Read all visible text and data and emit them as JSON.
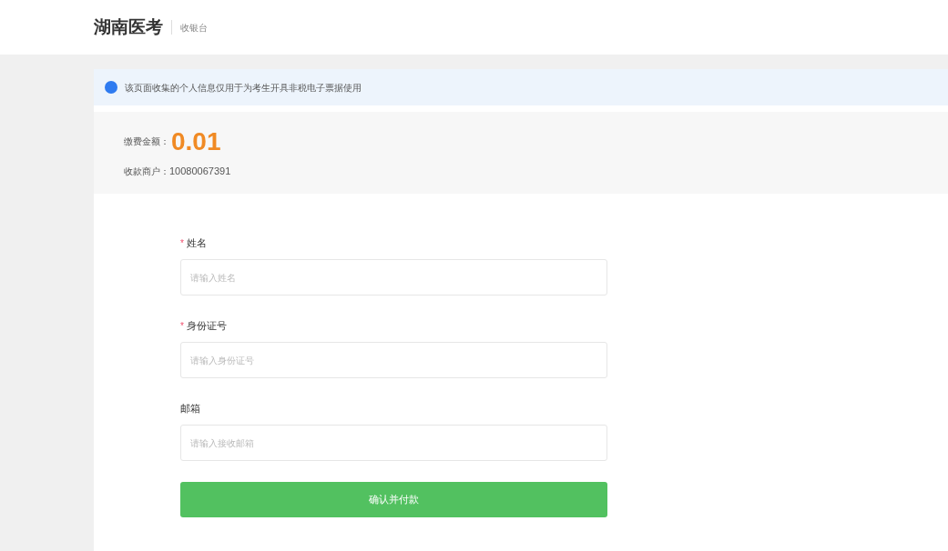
{
  "header": {
    "brand": "湖南医考",
    "subtitle": "收银台"
  },
  "notice": {
    "text": "该页面收集的个人信息仅用于为考生开具非税电子票据使用"
  },
  "payment": {
    "amount_label": "缴费金额：",
    "amount": "0.01",
    "merchant_label": "收款商户：",
    "merchant": "10080067391"
  },
  "fields": [
    {
      "mark": "*",
      "label": "姓名",
      "placeholder": "请输入姓名"
    },
    {
      "mark": "*",
      "label": "身份证号",
      "placeholder": "请输入身份证号"
    },
    {
      "label": "邮箱",
      "placeholder": "请输入接收邮箱"
    }
  ],
  "submit": {
    "label": "确认并付款"
  }
}
